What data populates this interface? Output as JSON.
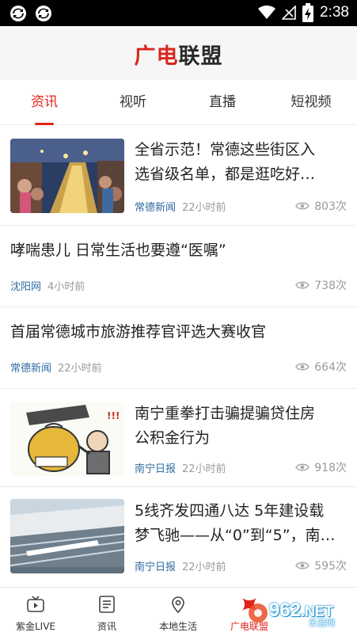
{
  "status_bar": {
    "time": "2:38",
    "icons": [
      "sync-icon",
      "sync-icon",
      "wifi-icon",
      "no-signal-icon",
      "battery-charging-icon"
    ]
  },
  "app": {
    "logo_red": "广电",
    "logo_dark": "联盟",
    "accent_color": "#e2231a"
  },
  "tabs": [
    {
      "label": "资讯",
      "active": true
    },
    {
      "label": "视听",
      "active": false
    },
    {
      "label": "直播",
      "active": false
    },
    {
      "label": "短视频",
      "active": false
    }
  ],
  "feed": [
    {
      "title_line1": "全省示范！常德这些街区入",
      "title_line2": "选省级名单，都是逛吃好…",
      "source": "常德新闻",
      "time": "22小时前",
      "views": "803次",
      "has_thumb": true,
      "thumb": "night-street-crowd-photo"
    },
    {
      "title_line1": "哮喘患儿 日常生活也要遵“医嘱”",
      "source": "沈阳网",
      "time": "4小时前",
      "views": "738次",
      "has_thumb": false
    },
    {
      "title_line1": "首届常德城市旅游推荐官评选大赛收官",
      "source": "常德新闻",
      "time": "22小时前",
      "views": "664次",
      "has_thumb": false
    },
    {
      "title_line1": "南宁重拳打击骗提骗贷住房",
      "title_line2": "公积金行为",
      "source": "南宁日报",
      "time": "22小时前",
      "views": "918次",
      "has_thumb": true,
      "thumb": "money-bag-cartoon"
    },
    {
      "title_line1": "5线齐发四通八达 5年建设载",
      "title_line2": "梦飞驰——从“0”到“5”，南…",
      "source": "南宁日报",
      "time": "22小时前",
      "views": "595次",
      "has_thumb": true,
      "thumb": "railway-station-aerial-photo"
    }
  ],
  "bottom_nav": [
    {
      "label": "紫金LIVE",
      "icon": "tv-icon",
      "active": false
    },
    {
      "label": "资讯",
      "icon": "news-list-icon",
      "active": false
    },
    {
      "label": "本地生活",
      "icon": "location-pin-icon",
      "active": false
    },
    {
      "label": "广电联盟",
      "icon": "alliance-logo-icon",
      "active": true
    }
  ],
  "watermark": {
    "text": "962",
    "suffix": ".NET",
    "sub": "乐游网"
  }
}
